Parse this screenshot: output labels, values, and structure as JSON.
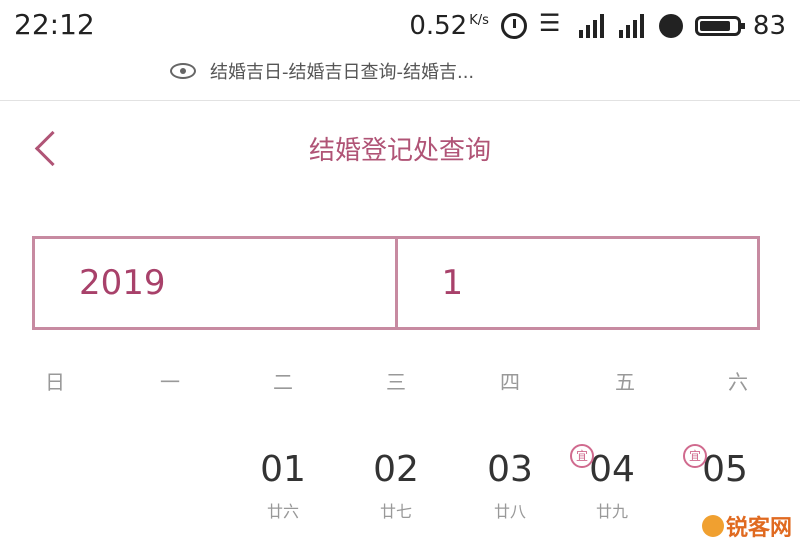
{
  "status_bar": {
    "time": "22:12",
    "net_speed": "0.52",
    "net_unit": "K/s",
    "battery": "83"
  },
  "url_bar": {
    "text": "结婚吉日-结婚吉日查询-结婚吉..."
  },
  "header": {
    "title": "结婚登记处查询"
  },
  "selector": {
    "year": "2019",
    "month": "1"
  },
  "weekdays": [
    "日",
    "一",
    "二",
    "三",
    "四",
    "五",
    "六"
  ],
  "days": [
    {
      "number": "01",
      "lunar": "廿六",
      "badge": ""
    },
    {
      "number": "02",
      "lunar": "廿七",
      "badge": ""
    },
    {
      "number": "03",
      "lunar": "廿八",
      "badge": ""
    },
    {
      "number": "04",
      "lunar": "廿九",
      "badge": "宜"
    },
    {
      "number": "05",
      "lunar": "",
      "badge": "宜"
    }
  ],
  "watermark": {
    "text": "锐客网"
  },
  "colors": {
    "accent": "#b05476",
    "border": "#c78aa1",
    "badge": "#d06a8e"
  }
}
